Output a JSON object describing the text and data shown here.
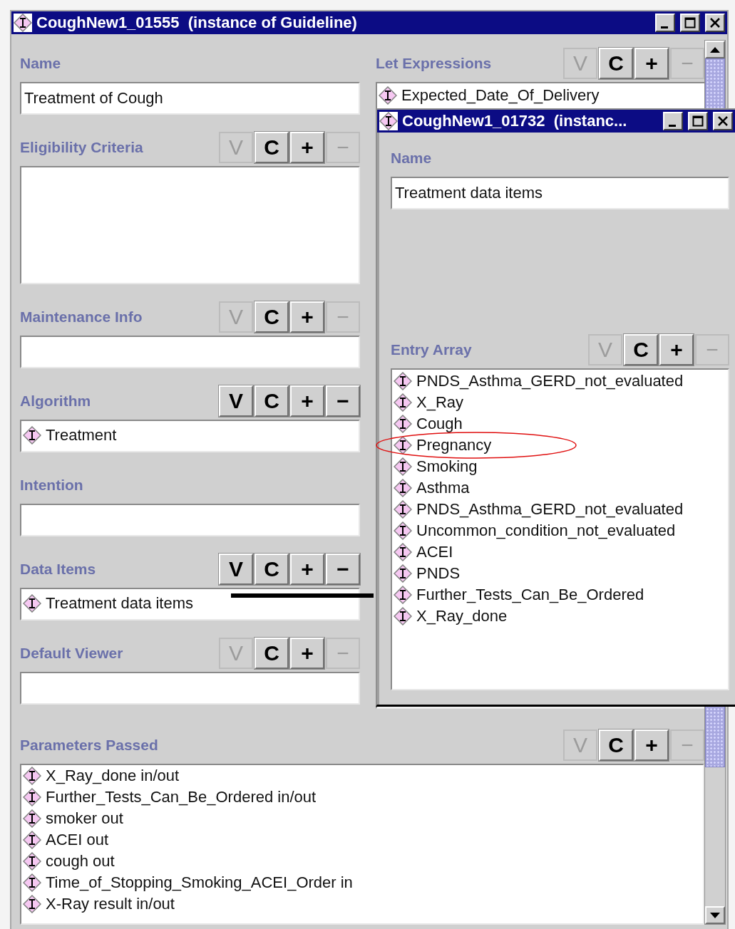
{
  "window": {
    "title": "CoughNew1_01555  (instance of Guideline)"
  },
  "left_fields": [
    {
      "label": "Name",
      "kind": "text",
      "value": "Treatment of Cough"
    },
    {
      "label": "Eligibility Criteria",
      "kind": "area",
      "buttons": [
        {
          "label": "V",
          "disabled": true
        },
        {
          "label": "C",
          "disabled": false
        },
        {
          "label": "+",
          "disabled": false
        },
        {
          "label": "−",
          "disabled": true
        }
      ]
    },
    {
      "label": "Maintenance Info",
      "kind": "list",
      "buttons": [
        {
          "label": "V",
          "disabled": true
        },
        {
          "label": "C",
          "disabled": false
        },
        {
          "label": "+",
          "disabled": false
        },
        {
          "label": "−",
          "disabled": true
        }
      ]
    },
    {
      "label": "Algorithm",
      "kind": "list",
      "buttons": [
        {
          "label": "V",
          "disabled": false
        },
        {
          "label": "C",
          "disabled": false
        },
        {
          "label": "+",
          "disabled": false
        },
        {
          "label": "−",
          "disabled": false
        }
      ],
      "items": [
        "Treatment"
      ]
    },
    {
      "label": "Intention",
      "kind": "text"
    },
    {
      "label": "Data Items",
      "kind": "list",
      "buttons": [
        {
          "label": "V",
          "disabled": false
        },
        {
          "label": "C",
          "disabled": false
        },
        {
          "label": "+",
          "disabled": false
        },
        {
          "label": "−",
          "disabled": false
        }
      ],
      "items": [
        "Treatment data items"
      ]
    },
    {
      "label": "Default Viewer",
      "kind": "list",
      "buttons": [
        {
          "label": "V",
          "disabled": true
        },
        {
          "label": "C",
          "disabled": false
        },
        {
          "label": "+",
          "disabled": false
        },
        {
          "label": "−",
          "disabled": true
        }
      ]
    }
  ],
  "let_expressions": {
    "label": "Let Expressions",
    "buttons": [
      {
        "label": "V",
        "disabled": true
      },
      {
        "label": "C",
        "disabled": false
      },
      {
        "label": "+",
        "disabled": false
      },
      {
        "label": "−",
        "disabled": true
      }
    ],
    "items": [
      "Expected_Date_Of_Delivery"
    ]
  },
  "parameters_passed": {
    "label": "Parameters Passed",
    "buttons": [
      {
        "label": "V",
        "disabled": true
      },
      {
        "label": "C",
        "disabled": false
      },
      {
        "label": "+",
        "disabled": false
      },
      {
        "label": "−",
        "disabled": true
      }
    ],
    "items": [
      "X_Ray_done in/out",
      "Further_Tests_Can_Be_Ordered in/out",
      "smoker out",
      "ACEI out",
      "cough out",
      "Time_of_Stopping_Smoking_ACEI_Order in",
      "X-Ray result in/out"
    ]
  },
  "sub_window": {
    "title": "CoughNew1_01732  (instanc...",
    "name": {
      "label": "Name",
      "value": "Treatment data items"
    },
    "entry_array": {
      "label": "Entry Array",
      "buttons": [
        {
          "label": "V",
          "disabled": true
        },
        {
          "label": "C",
          "disabled": false
        },
        {
          "label": "+",
          "disabled": false
        },
        {
          "label": "−",
          "disabled": true
        }
      ],
      "items": [
        "PNDS_Asthma_GERD_not_evaluated",
        "X_Ray",
        "Cough",
        "Pregnancy",
        "Smoking",
        "Asthma",
        "PNDS_Asthma_GERD_not_evaluated",
        "Uncommon_condition_not_evaluated",
        "ACEI",
        "PNDS",
        "Further_Tests_Can_Be_Ordered",
        "X_Ray_done"
      ]
    }
  }
}
